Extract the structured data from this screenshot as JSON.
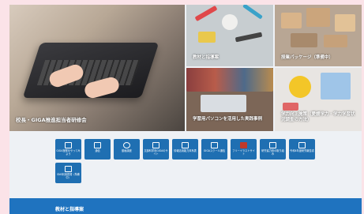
{
  "hero": {
    "main_caption": "校長・GIGA推進担当者研修会",
    "tiles": [
      {
        "caption": "教材と指導案"
      },
      {
        "caption": "授業パッケージ（準備中）"
      },
      {
        "caption": "学習用パソコンを活用した実践事例"
      },
      {
        "caption": "学力向上施策（愛媛学力・学力学習状況調査の方法）"
      }
    ]
  },
  "quick_links": [
    {
      "label": "GIGA授業をやってみよう",
      "icon": "monitor-icon"
    },
    {
      "label": "通信",
      "icon": "document-icon"
    },
    {
      "label": "動画講座",
      "icon": "video-icon"
    },
    {
      "label": "文部科学省GIGAのサイト",
      "icon": "globe-icon"
    },
    {
      "label": "情報活用能力体系表",
      "icon": "table-icon"
    },
    {
      "label": "GIGAスクール通信",
      "icon": "newsletter-icon"
    },
    {
      "label": "フリーイラストサイト",
      "icon": "image-icon"
    },
    {
      "label": "研究協力校の取り組み",
      "icon": "chart-icon"
    },
    {
      "label": "令和4年度研究報告書",
      "icon": "report-icon"
    },
    {
      "label": "SNS利用啓発（準備中）",
      "icon": "chat-icon"
    }
  ],
  "section": {
    "title": "教材と指導案"
  },
  "colors": {
    "accent": "#1f73bf",
    "button": "#1f6fb2",
    "background": "#fbe3e8"
  }
}
